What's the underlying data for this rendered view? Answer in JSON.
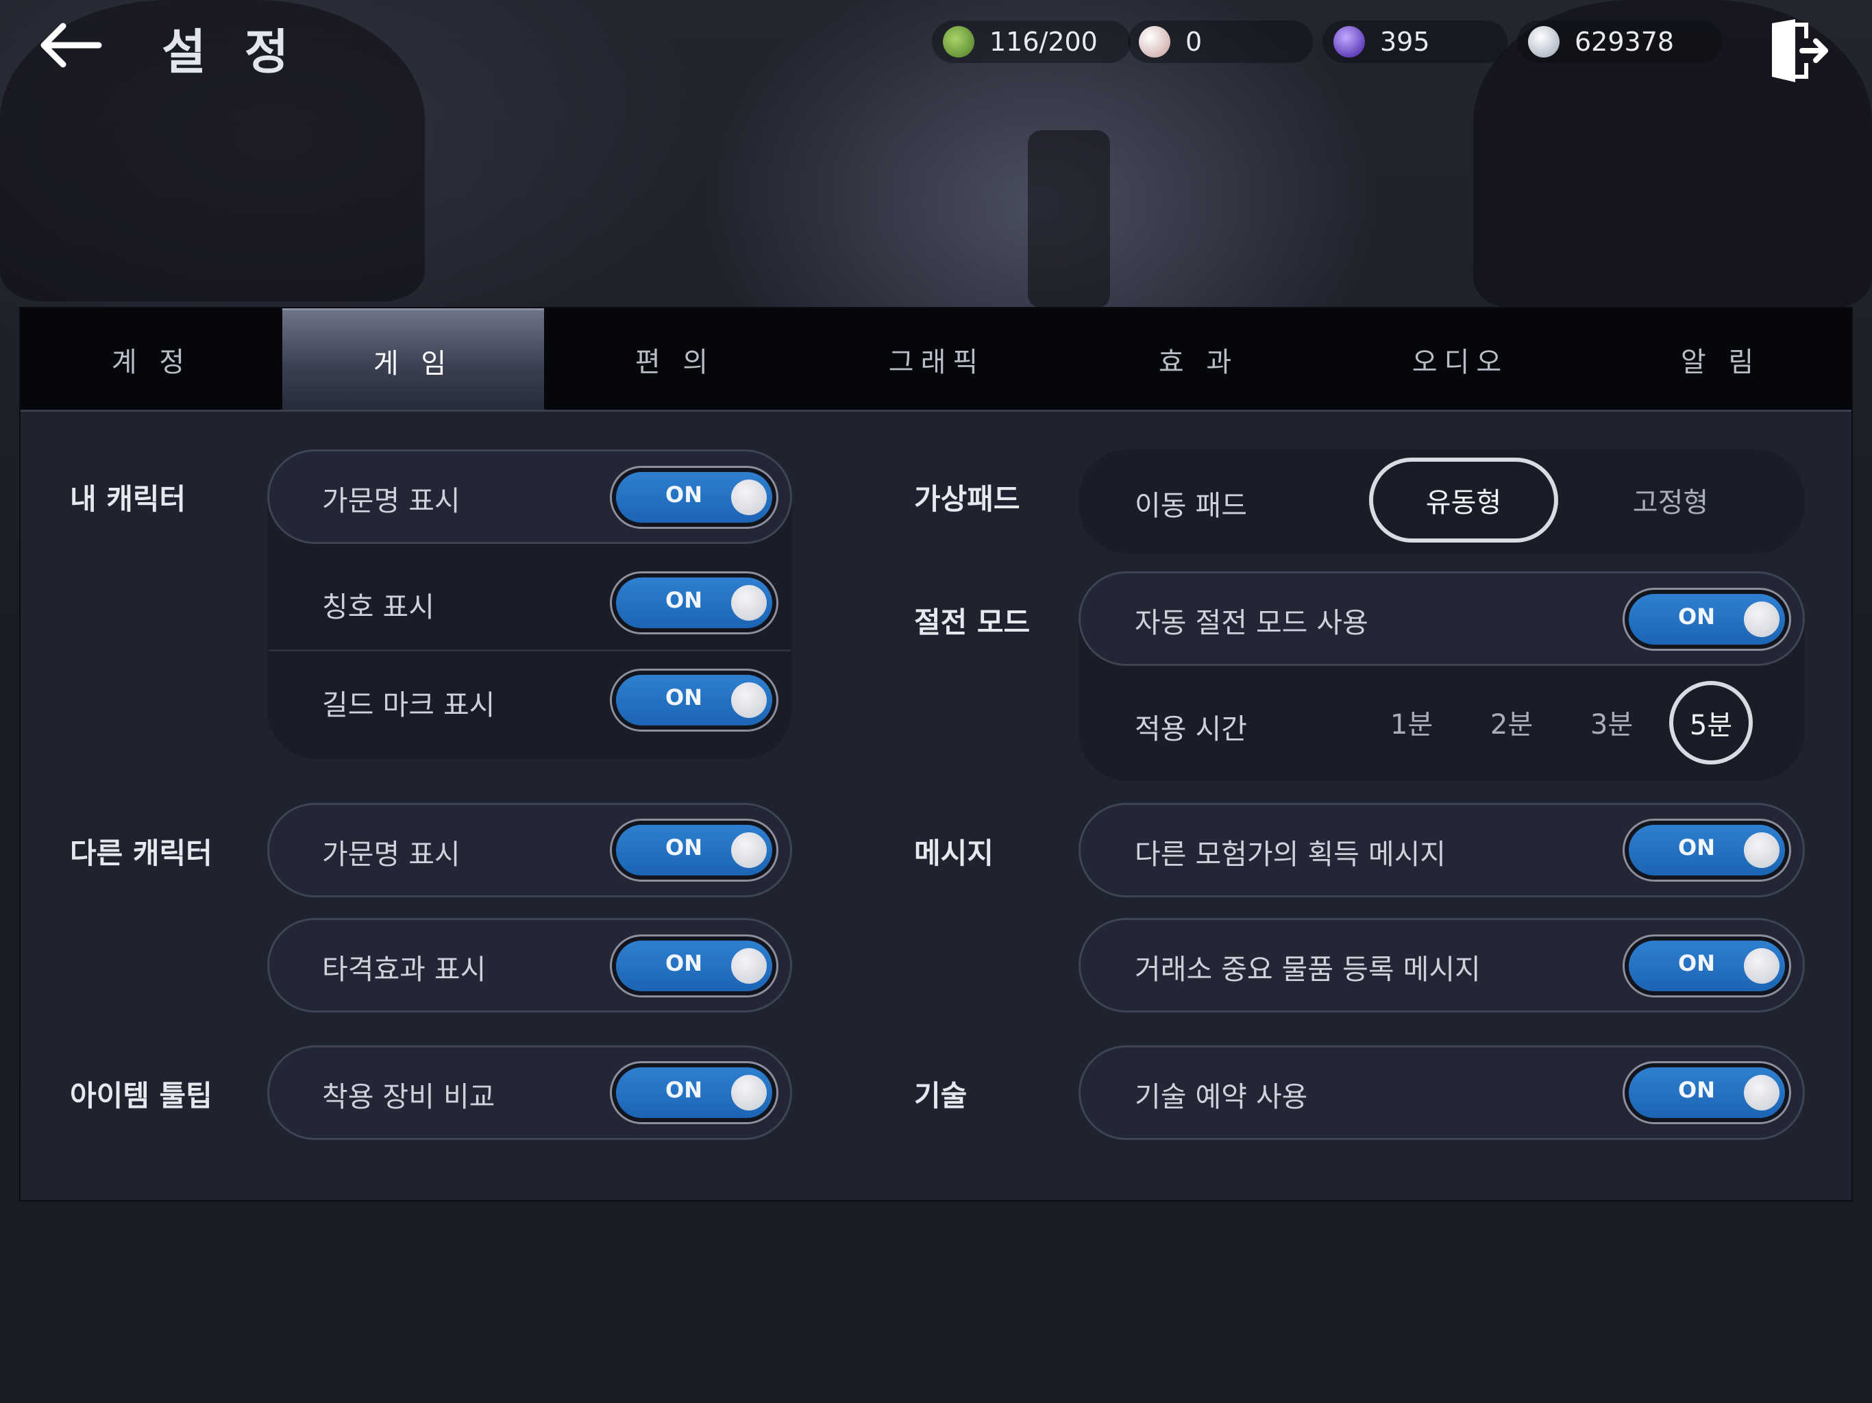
{
  "header": {
    "title": "설 정",
    "resources": [
      {
        "icon": "green-seal-icon",
        "value": "116/200",
        "color": "#6b9a3a"
      },
      {
        "icon": "pearl-icon",
        "value": "0",
        "color": "#e6c8c4"
      },
      {
        "icon": "purple-crystal-icon",
        "value": "395",
        "color": "#5a2bd0"
      },
      {
        "icon": "silver-coin-icon",
        "value": "629378",
        "color": "#cfd6e4"
      }
    ]
  },
  "tabs": [
    {
      "label": "계 정"
    },
    {
      "label": "게 임"
    },
    {
      "label": "편 의"
    },
    {
      "label": "그래픽"
    },
    {
      "label": "효 과"
    },
    {
      "label": "오디오"
    },
    {
      "label": "알 림"
    }
  ],
  "active_tab": "게 임",
  "left": {
    "my_character": {
      "label": "내 캐릭터",
      "rows": [
        {
          "label": "가문명 표시",
          "state": "ON"
        },
        {
          "label": "칭호 표시",
          "state": "ON"
        },
        {
          "label": "길드 마크 표시",
          "state": "ON"
        }
      ]
    },
    "other_character": {
      "label": "다른 캐릭터",
      "rows": [
        {
          "label": "가문명 표시",
          "state": "ON"
        },
        {
          "label": "타격효과 표시",
          "state": "ON"
        }
      ]
    },
    "item_tooltip": {
      "label": "아이템 툴팁",
      "rows": [
        {
          "label": "착용 장비 비교",
          "state": "ON"
        }
      ]
    }
  },
  "right": {
    "virtual_pad": {
      "label": "가상패드",
      "row_label": "이동 패드",
      "options": [
        "유동형",
        "고정형"
      ],
      "selected": "유동형"
    },
    "power_save": {
      "label": "절전 모드",
      "row": {
        "label": "자동 절전 모드 사용",
        "state": "ON"
      },
      "time_label": "적용 시간",
      "time_options": [
        "1분",
        "2분",
        "3분",
        "5분"
      ],
      "selected_time": "5분"
    },
    "message": {
      "label": "메시지",
      "rows": [
        {
          "label": "다른 모험가의 획득 메시지",
          "state": "ON"
        },
        {
          "label": "거래소 중요 물품 등록 메시지",
          "state": "ON"
        }
      ]
    },
    "skill": {
      "label": "기술",
      "rows": [
        {
          "label": "기술 예약 사용",
          "state": "ON"
        }
      ]
    }
  },
  "colors": {
    "toggle_on": "#1f6ec0",
    "panel": "#1f2330",
    "tab_active": "#4a5063"
  }
}
